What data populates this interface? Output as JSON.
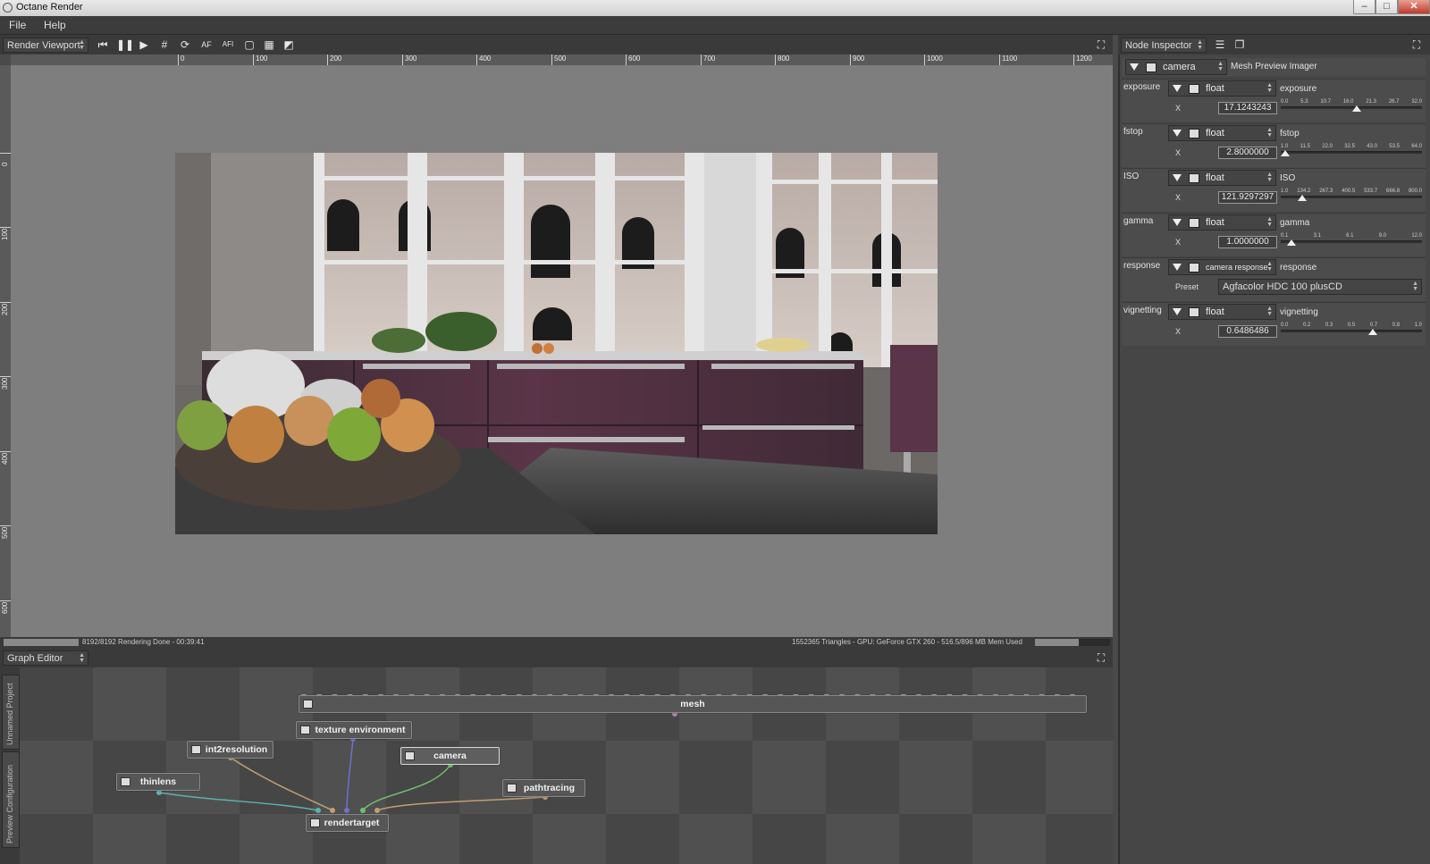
{
  "window": {
    "title": "Octane Render"
  },
  "menu": [
    "File",
    "Help"
  ],
  "viewport_toolbar": {
    "mode": "Render Viewport",
    "buttons": [
      "AF",
      "AFI"
    ]
  },
  "ruler": {
    "top_ticks": [
      "0",
      "100",
      "200",
      "300",
      "400",
      "500",
      "600",
      "700",
      "800",
      "900",
      "1000",
      "1100",
      "1200"
    ],
    "left_ticks": [
      "0",
      "100",
      "200",
      "300",
      "400",
      "500",
      "600"
    ]
  },
  "status": {
    "left": "8192/8192 Rendering Done - 00:39:41",
    "right": "1552365 Triangles - GPU: GeForce GTX 260 - 516.5/896 MB Mem Used",
    "progress": 1.0,
    "mem_fraction": 0.58
  },
  "graph_editor": {
    "title": "Graph Editor",
    "side_tabs": [
      "Unnamed Project",
      "Preview Configuration"
    ],
    "nodes": {
      "mesh": "mesh",
      "texture_environment": "texture environment",
      "int2resolution": "int2resolution",
      "camera": "camera",
      "thinlens": "thinlens",
      "pathtracing": "pathtracing",
      "rendertarget": "rendertarget"
    },
    "colors": {
      "grid_dark": "#464646",
      "grid_light": "#505050",
      "edge_teal": "#5fb0b0",
      "edge_tan": "#c0a070",
      "edge_blue": "#6f6fd0",
      "edge_green": "#6fc06f"
    }
  },
  "node_inspector": {
    "title": "Node Inspector",
    "node_type": "camera",
    "node_name": "Mesh Preview Imager",
    "params": [
      {
        "label": "exposure",
        "type": "float",
        "name": "exposure",
        "axis": "X",
        "value": "17.1243243",
        "ticks": [
          "0.0",
          "5.3",
          "10.7",
          "16.0",
          "21.3",
          "26.7",
          "32.0"
        ],
        "level": 0.535
      },
      {
        "label": "fstop",
        "type": "float",
        "name": "fstop",
        "axis": "X",
        "value": "2.8000000",
        "ticks": [
          "1.0",
          "11.5",
          "22.0",
          "32.5",
          "43.0",
          "53.5",
          "64.0"
        ],
        "level": 0.029
      },
      {
        "label": "ISO",
        "type": "float",
        "name": "ISO",
        "axis": "X",
        "value": "121.9297297",
        "ticks": [
          "1.0",
          "134.2",
          "267.3",
          "400.5",
          "533.7",
          "666.8",
          "800.0"
        ],
        "level": 0.151
      },
      {
        "label": "gamma",
        "type": "float",
        "name": "gamma",
        "axis": "X",
        "value": "1.0000000",
        "ticks": [
          "0.1",
          "3.1",
          "6.1",
          "9.0",
          "12.0"
        ],
        "level": 0.075
      },
      {
        "label": "response",
        "type": "camera response",
        "name": "response",
        "axis": "Preset",
        "value": "Agfacolor HDC 100 plusCD"
      },
      {
        "label": "vignetting",
        "type": "float",
        "name": "vignetting",
        "axis": "X",
        "value": "0.6486486",
        "ticks": [
          "0.0",
          "0.2",
          "0.3",
          "0.5",
          "0.7",
          "0.8",
          "1.0"
        ],
        "level": 0.649
      }
    ]
  }
}
